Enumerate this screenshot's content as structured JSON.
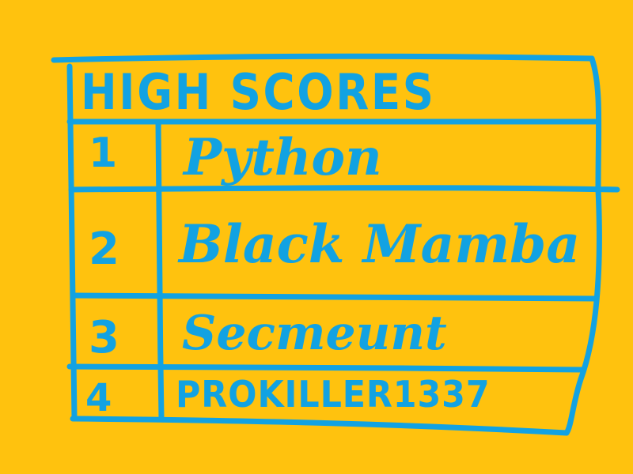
{
  "title": "HIGH SCORES",
  "ink_color": "#12A2E2",
  "background_color": "#FFC20E",
  "scores": [
    {
      "rank": "1",
      "name": "Python"
    },
    {
      "rank": "2",
      "name": "Black Mamba"
    },
    {
      "rank": "3",
      "name": "Secmeunt"
    },
    {
      "rank": "4",
      "name": "PROKILLER1337"
    }
  ]
}
